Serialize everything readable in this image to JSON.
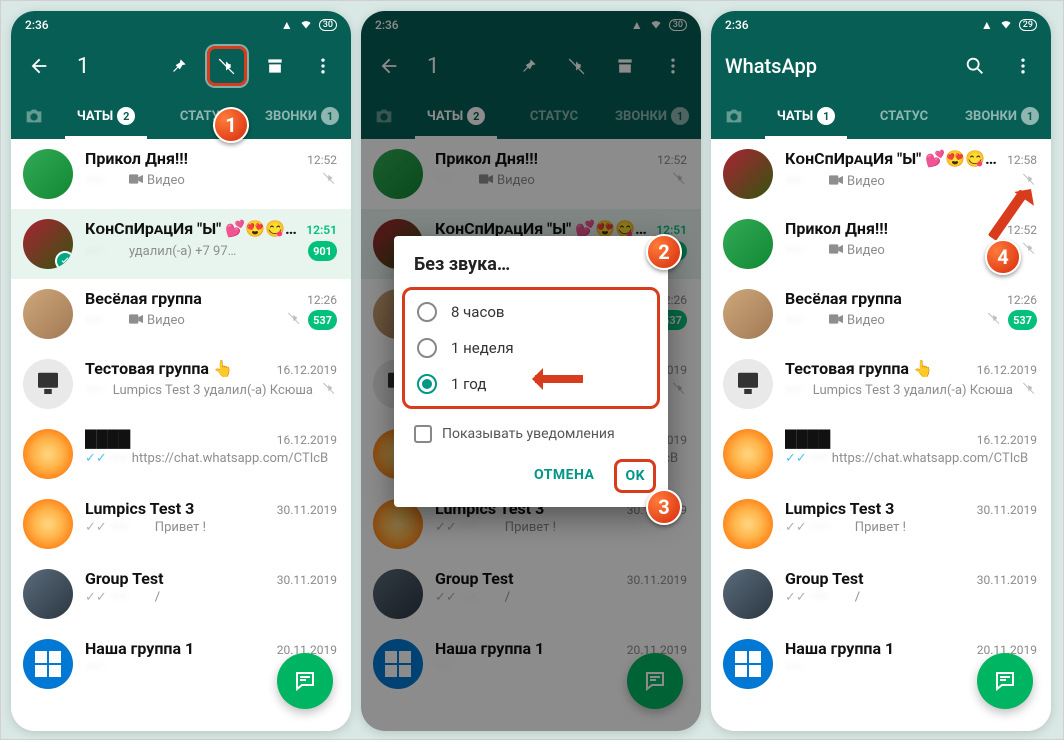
{
  "statusbar": {
    "time": "2:36",
    "battery_left": "30",
    "battery_right": "29"
  },
  "header_sel": {
    "count_label": "1"
  },
  "header_main": {
    "title": "WhatsApp"
  },
  "tabs": {
    "chats": "ЧАТЫ",
    "status": "СТАТУС",
    "calls": "ЗВОНКИ",
    "badge_chats_2": "2",
    "badge_chats_1": "1",
    "badge_calls": "1"
  },
  "dialog": {
    "title": "Без звука…",
    "opt1": "8 часов",
    "opt2": "1 неделя",
    "opt3": "1 год",
    "checkbox": "Показывать уведомления",
    "cancel": "ОТМЕНА",
    "ok": "OK"
  },
  "callouts": {
    "1": "1",
    "2": "2",
    "3": "3",
    "4": "4"
  },
  "chats1": [
    {
      "name": "Прикол Дня!!!",
      "sub_pre": "",
      "sub": "Видео",
      "video": true,
      "time": "12:52",
      "muted": true
    },
    {
      "name": "КᴏнСпИрᴀцИя \"Ы\" 💕😍😋😜",
      "sub": "удалил(-а) +7 97…",
      "time": "12:51",
      "unread": "901",
      "selected": true,
      "time_unread": true
    },
    {
      "name": "Весёлая группа",
      "sub": "Видео",
      "video": true,
      "time": "12:26",
      "muted": true,
      "unread": "537"
    },
    {
      "name": "Тестовая группа 👆",
      "sub": "Lumpics Test 3 удалил(-а) Ксюша",
      "time": "16.12.2019",
      "muted": true
    },
    {
      "name": "",
      "sub": "https://chat.whatsapp.com/CTIcBFu…",
      "time": "16.12.2019",
      "ticks": "blue",
      "blur_name": true
    },
    {
      "name": "Lumpics Test 3",
      "sub": "Привет !",
      "time": "30.11.2019",
      "ticks": "grey"
    },
    {
      "name": "Group Test",
      "sub": "/",
      "time": "30.11.2019",
      "ticks": "grey"
    },
    {
      "name": "Наша группа 1",
      "sub": "",
      "time": "20.11.2019"
    }
  ],
  "chats3": [
    {
      "name": "КᴏнСпИрᴀцИя \"Ы\" 💕😍😋😜",
      "sub": "Видео",
      "video": true,
      "time": "12:58",
      "muted": true
    },
    {
      "name": "Прикол Дня!!!",
      "sub": "Видео",
      "video": true,
      "time": "12:52",
      "muted": true
    },
    {
      "name": "Весёлая группа",
      "sub": "Видео",
      "video": true,
      "time": "12:26",
      "muted": true,
      "unread": "537"
    },
    {
      "name": "Тестовая группа 👆",
      "sub": "Lumpics Test 3 удалил(-а) Ксюша",
      "time": "16.12.2019",
      "muted": true
    },
    {
      "name": "",
      "sub": "https://chat.whatsapp.com/CTIcBFu…",
      "time": "16.12.2019",
      "ticks": "blue",
      "blur_name": true
    },
    {
      "name": "Lumpics Test 3",
      "sub": "Привет !",
      "time": "30.11.2019",
      "ticks": "grey"
    },
    {
      "name": "Group Test",
      "sub": "/",
      "time": "30.11.2019",
      "ticks": "grey"
    },
    {
      "name": "Наша группа 1",
      "sub": "",
      "time": "20.11.2019"
    }
  ]
}
